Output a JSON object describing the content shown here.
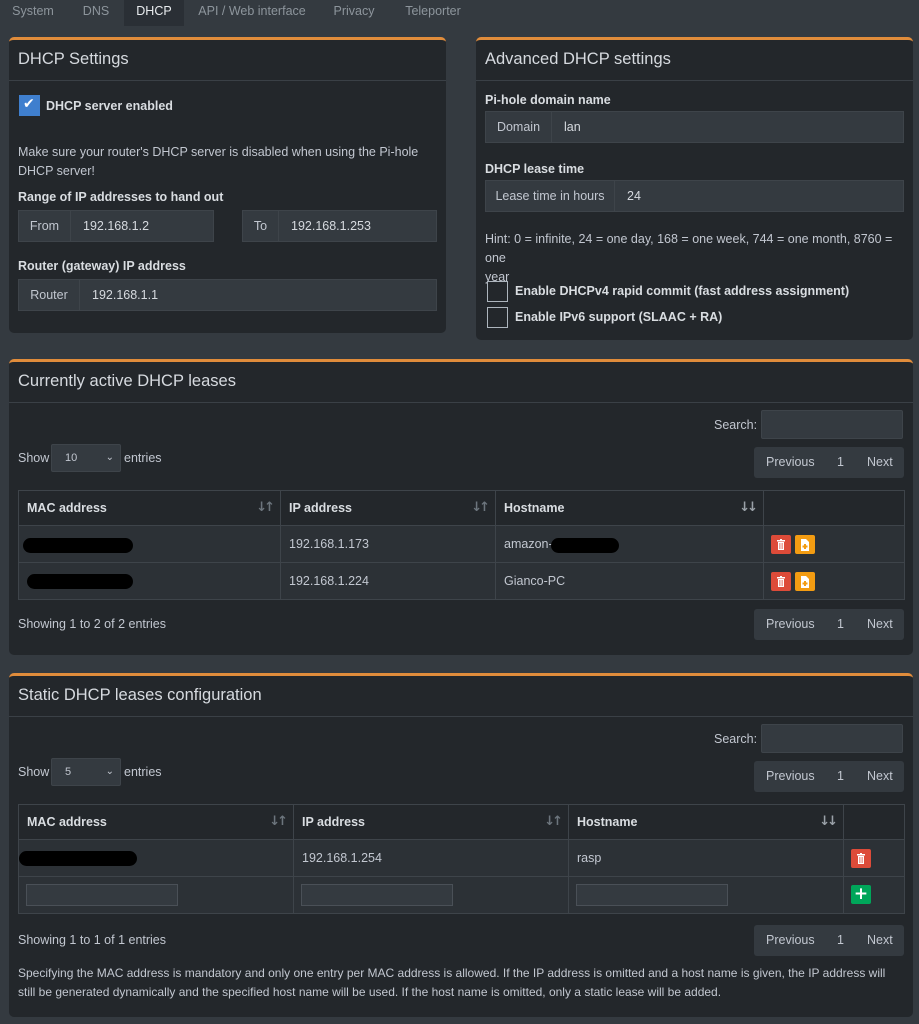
{
  "tabs": [
    "System",
    "DNS",
    "DHCP",
    "API / Web interface",
    "Privacy",
    "Teleporter"
  ],
  "dhcp_settings": {
    "title": "DHCP Settings",
    "enabled_label": "DHCP server enabled",
    "enabled_checked": true,
    "warning_line1": "Make sure your router's DHCP server is disabled when using the Pi-hole",
    "warning_line2": "DHCP server!",
    "range_label": "Range of IP addresses to hand out",
    "from_label": "From",
    "from_value": "192.168.1.2",
    "to_label": "To",
    "to_value": "192.168.1.253",
    "router_section_label": "Router (gateway) IP address",
    "router_label": "Router",
    "router_value": "192.168.1.1"
  },
  "advanced": {
    "title": "Advanced DHCP settings",
    "domain_section_label": "Pi-hole domain name",
    "domain_label": "Domain",
    "domain_value": "lan",
    "lease_section_label": "DHCP lease time",
    "lease_label": "Lease time in hours",
    "lease_value": "24",
    "hint_line1": "Hint: 0 = infinite, 24 = one day, 168 = one week, 744 = one month, 8760 = one",
    "hint_line2": "year",
    "rapid_commit_label": "Enable DHCPv4 rapid commit (fast address assignment)",
    "ipv6_label": "Enable IPv6 support (SLAAC + RA)"
  },
  "active_leases": {
    "title": "Currently active DHCP leases",
    "search_label": "Search:",
    "show_label": "Show",
    "show_value": "10",
    "entries_label": "entries",
    "columns": [
      "MAC address",
      "IP address",
      "Hostname"
    ],
    "rows": [
      {
        "mac": "",
        "ip": "192.168.1.173",
        "hostname": "amazon-"
      },
      {
        "mac": "",
        "ip": "192.168.1.224",
        "hostname": "Gianco-PC"
      }
    ],
    "info": "Showing 1 to 2 of 2 entries",
    "pager": {
      "prev": "Previous",
      "page": "1",
      "next": "Next"
    }
  },
  "static_leases": {
    "title": "Static DHCP leases configuration",
    "search_label": "Search:",
    "show_label": "Show",
    "show_value": "5",
    "entries_label": "entries",
    "columns": [
      "MAC address",
      "IP address",
      "Hostname"
    ],
    "rows": [
      {
        "mac": "",
        "ip": "192.168.1.254",
        "hostname": "rasp"
      }
    ],
    "info": "Showing 1 to 1 of 1 entries",
    "pager": {
      "prev": "Previous",
      "page": "1",
      "next": "Next"
    },
    "note_line1": "Specifying the MAC address is mandatory and only one entry per MAC address is allowed. If the IP address is omitted and a host name is given, the IP address will",
    "note_line2": "still be generated dynamically and the specified host name will be used. If the host name is omitted, only a static lease will be added."
  },
  "colors": {
    "accent": "#e08c3b",
    "delete": "#dd4b39",
    "copy": "#f39c12",
    "add": "#00a65a",
    "checkbox": "#3f7fce"
  }
}
